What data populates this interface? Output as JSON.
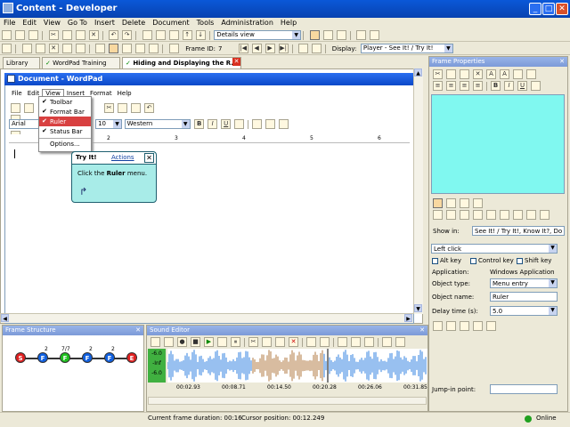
{
  "window": {
    "title": "Content - Developer",
    "min": "_",
    "max": "□",
    "close": "✕"
  },
  "menubar": [
    "File",
    "Edit",
    "View",
    "Go To",
    "Insert",
    "Delete",
    "Document",
    "Tools",
    "Administration",
    "Help"
  ],
  "toolbar": {
    "view_combo": "Details view",
    "frame_id_label": "Frame ID:",
    "frame_id": "7",
    "display_label": "Display:",
    "display_combo": "Player - See It! / Try It!"
  },
  "tabs": [
    {
      "label": "Library"
    },
    {
      "label": "WordPad Training"
    },
    {
      "label": "Hiding and Displaying the R..."
    }
  ],
  "wordpad": {
    "title": "Document - WordPad",
    "menu": [
      "File",
      "Edit",
      "View",
      "Insert",
      "Format",
      "Help"
    ],
    "font": "Arial",
    "size": "10",
    "script": "Western",
    "format_buttons": [
      "B",
      "I",
      "U"
    ],
    "ruler_marks": [
      "1",
      "2",
      "3",
      "4",
      "5",
      "6"
    ]
  },
  "view_menu": {
    "items": [
      {
        "label": "Toolbar",
        "checked": true,
        "highlighted": false
      },
      {
        "label": "Format Bar",
        "checked": true,
        "highlighted": false
      },
      {
        "label": "Ruler",
        "checked": true,
        "highlighted": true
      },
      {
        "label": "Status Bar",
        "checked": true,
        "highlighted": false
      },
      {
        "label": "Options...",
        "checked": false,
        "highlighted": false
      }
    ]
  },
  "tryit": {
    "title": "Try It!",
    "actions": "Actions",
    "close": "✕",
    "text_prefix": "Click the ",
    "text_bold": "Ruler",
    "text_suffix": " menu."
  },
  "frame_properties": {
    "title": "Frame Properties",
    "show_in_label": "Show in:",
    "show_in": "See It! / Try It!, Know It?, Do It!",
    "event": "Left click",
    "alt_key": "Alt key",
    "control_key": "Control key",
    "shift_key": "Shift key",
    "application_label": "Application:",
    "application": "Windows Application",
    "object_type_label": "Object type:",
    "object_type": "Menu entry",
    "object_name_label": "Object name:",
    "object_name": "Ruler",
    "delay_label": "Delay time (s):",
    "delay": "5.0",
    "jump_label": "Jump-in point:"
  },
  "frame_structure": {
    "title": "Frame Structure",
    "nodes": [
      {
        "letter": "S",
        "color": "#e02020",
        "num": ""
      },
      {
        "letter": "F",
        "color": "#1060e0",
        "num": "2"
      },
      {
        "letter": "F",
        "color": "#20c020",
        "num": "7/7"
      },
      {
        "letter": "F",
        "color": "#1060e0",
        "num": "2"
      },
      {
        "letter": "F",
        "color": "#1060e0",
        "num": "2"
      },
      {
        "letter": "E",
        "color": "#e02020",
        "num": ""
      }
    ]
  },
  "sound_editor": {
    "title": "Sound Editor",
    "level": [
      "-6.0",
      "-Inf",
      "-6.0"
    ],
    "times": [
      "00:02.93",
      "00:08.71",
      "00:14.50",
      "00:20.28",
      "00:26.06",
      "00:31.85"
    ]
  },
  "status": {
    "duration": "Current frame duration: 00:16",
    "cursor": "Cursor position: 00:12.249",
    "online": "Online"
  }
}
